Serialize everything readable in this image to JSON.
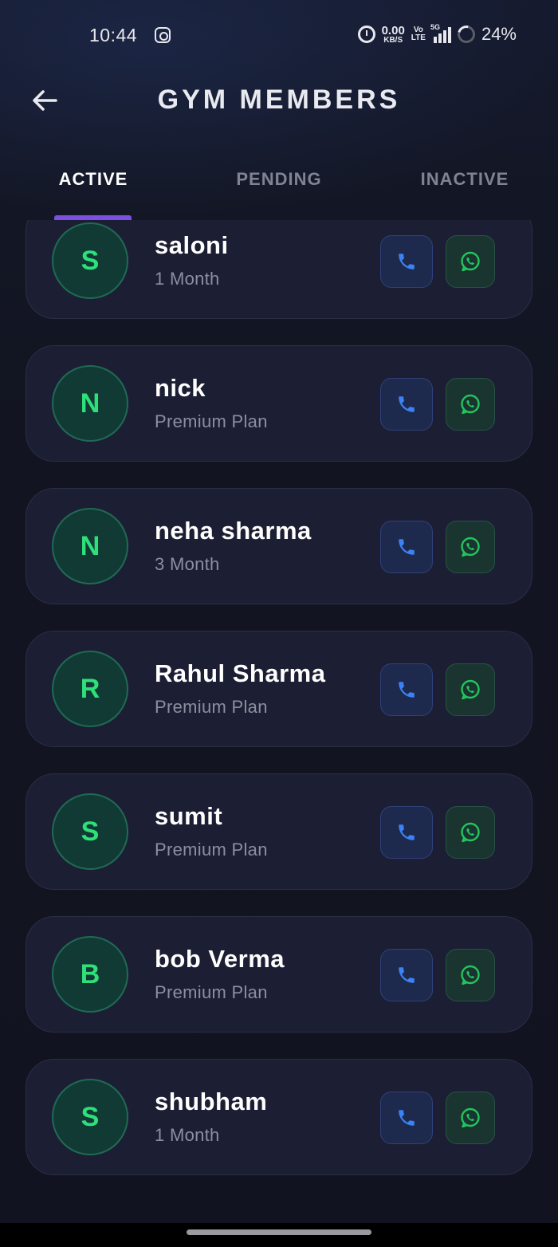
{
  "status_bar": {
    "time": "10:44",
    "net_speed_value": "0.00",
    "net_speed_unit": "KB/S",
    "volte_top": "Vo",
    "volte_bottom": "LTE",
    "network": "5G",
    "battery": "24%",
    "icons": [
      "instagram-icon",
      "alarm-icon",
      "signal-icon",
      "battery-icon"
    ]
  },
  "header": {
    "title": "GYM MEMBERS",
    "back_icon": "arrow-left-icon"
  },
  "tabs": [
    {
      "label": "ACTIVE",
      "active": true
    },
    {
      "label": "PENDING",
      "active": false
    },
    {
      "label": "INACTIVE",
      "active": false
    }
  ],
  "members": [
    {
      "initial": "S",
      "name": "saloni",
      "plan": "1 Month"
    },
    {
      "initial": "N",
      "name": "nick",
      "plan": "Premium Plan"
    },
    {
      "initial": "N",
      "name": "neha sharma",
      "plan": "3 Month"
    },
    {
      "initial": "R",
      "name": "Rahul Sharma",
      "plan": "Premium Plan"
    },
    {
      "initial": "S",
      "name": "sumit",
      "plan": "Premium Plan"
    },
    {
      "initial": "B",
      "name": "bob Verma",
      "plan": "Premium Plan"
    },
    {
      "initial": "S",
      "name": "shubham",
      "plan": "1 Month"
    }
  ],
  "colors": {
    "background": "#121421",
    "card": "#1c1f33",
    "accent_tab": "#7b4fe0",
    "avatar_text": "#2ee07a",
    "call_icon": "#3b82f6",
    "whatsapp_icon": "#22c55e"
  }
}
